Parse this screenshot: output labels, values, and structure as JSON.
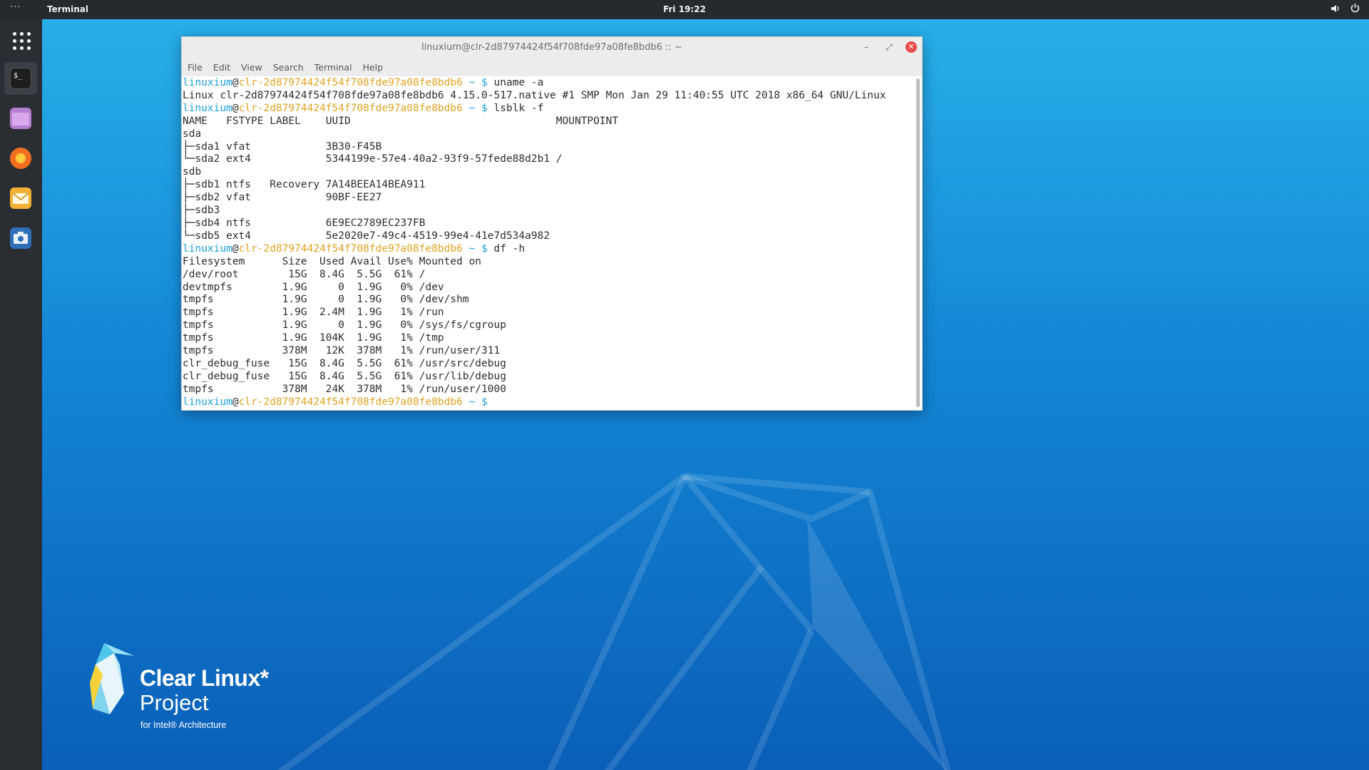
{
  "topbar": {
    "activities": "···",
    "app_name": "Terminal",
    "clock": "Fri 19:22"
  },
  "dock": {
    "items": [
      "apps-grid-icon",
      "terminal-icon",
      "files-icon",
      "firefox-icon",
      "mail-icon",
      "screenshot-icon"
    ]
  },
  "window": {
    "title": "linuxium@clr-2d87974424f54f708fde97a08fe8bdb6 :: ~",
    "buttons": {
      "minimize": "–",
      "maximize": "⤢",
      "close": "✕"
    },
    "menu": [
      "File",
      "Edit",
      "View",
      "Search",
      "Terminal",
      "Help"
    ]
  },
  "prompt": {
    "user": "linuxium",
    "at": "@",
    "host": "clr-2d87974424f54f708fde97a08fe8bdb6",
    "dir": " ~ ",
    "sym": "$"
  },
  "terminal": {
    "blocks": [
      {
        "cmd": "uname -a",
        "output": [
          "Linux clr-2d87974424f54f708fde97a08fe8bdb6 4.15.0-517.native #1 SMP Mon Jan 29 11:40:55 UTC 2018 x86_64 GNU/Linux"
        ]
      },
      {
        "cmd": "lsblk -f",
        "output": [
          "NAME   FSTYPE LABEL    UUID                                 MOUNTPOINT",
          "sda",
          "├─sda1 vfat            3B30-F45B",
          "└─sda2 ext4            5344199e-57e4-40a2-93f9-57fede88d2b1 /",
          "sdb",
          "├─sdb1 ntfs   Recovery 7A14BEEA14BEA911",
          "├─sdb2 vfat            90BF-EE27",
          "├─sdb3",
          "├─sdb4 ntfs            6E9EC2789EC237FB",
          "└─sdb5 ext4            5e2020e7-49c4-4519-99e4-41e7d534a982"
        ]
      },
      {
        "cmd": "df -h",
        "output": [
          "Filesystem      Size  Used Avail Use% Mounted on",
          "/dev/root        15G  8.4G  5.5G  61% /",
          "devtmpfs        1.9G     0  1.9G   0% /dev",
          "tmpfs           1.9G     0  1.9G   0% /dev/shm",
          "tmpfs           1.9G  2.4M  1.9G   1% /run",
          "tmpfs           1.9G     0  1.9G   0% /sys/fs/cgroup",
          "tmpfs           1.9G  104K  1.9G   1% /tmp",
          "tmpfs           378M   12K  378M   1% /run/user/311",
          "clr_debug_fuse   15G  8.4G  5.5G  61% /usr/src/debug",
          "clr_debug_fuse   15G  8.4G  5.5G  61% /usr/lib/debug",
          "tmpfs           378M   24K  378M   1% /run/user/1000"
        ]
      },
      {
        "cmd": "",
        "output": []
      }
    ]
  },
  "logo": {
    "line1": "Clear Linux*",
    "line2": "Project",
    "line3": "for Intel® Architecture"
  },
  "colors": {
    "prompt_user": "#1b9fd9",
    "prompt_host": "#e0a321",
    "desktop_top": "#29b1ea",
    "desktop_bottom": "#0a5fb8",
    "close_button": "#e94b4b"
  }
}
